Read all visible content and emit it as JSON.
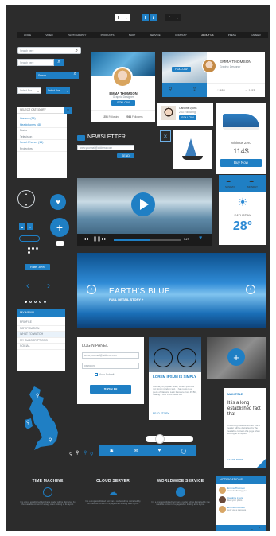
{
  "social": {
    "icons": [
      "f",
      "t",
      "f",
      "t",
      "f",
      "t"
    ]
  },
  "nav": {
    "items": [
      "HOME",
      "VIDEO",
      "PHOTOGRAPHY",
      "PRODUCTS",
      "SHOP",
      "SERVICE",
      "COMPANY",
      "ABOUT US",
      "PRESS",
      "CAREER"
    ],
    "active": 7
  },
  "search": {
    "placeholder1": "Search here",
    "placeholder2": "Search here",
    "button": "Search"
  },
  "selects": {
    "a": "Select Box",
    "b": "Select Box"
  },
  "category": {
    "header": "SELECT CATEGORY",
    "items": [
      "Camera (35)",
      "Headphones (48)",
      "Radio",
      "Television",
      "Smart Phones (14)",
      "Projectors"
    ]
  },
  "profile1": {
    "name": "EMMA THOMSON",
    "role": "Graphic Designer",
    "button": "FOLLOW",
    "stats": [
      {
        "n": "253",
        "t": "Following"
      },
      {
        "n": "2564",
        "t": "Followers"
      }
    ]
  },
  "profile2": {
    "name": "EMMA THOMSON",
    "role": "Graphic Designer",
    "button": "FOLLOW",
    "stats": [
      "654",
      "1453"
    ]
  },
  "profile3": {
    "name": "Caroline Lyons",
    "role": "253 Following",
    "button": "FOLLOW"
  },
  "newsletter": {
    "title": "NEWSLETTER",
    "placeholder": "www.yourmail@address.com",
    "button": "SEND"
  },
  "shoe": {
    "name": "Minimus Zero",
    "price": "114$",
    "button": "Buy Now"
  },
  "weather": {
    "d1": "SUNDAY",
    "d2": "MONDAY",
    "day": "SATURDAY",
    "temp": "28°"
  },
  "player": {
    "time": "3:47"
  },
  "rate": {
    "label": "Rate: 30%"
  },
  "hero": {
    "title": "EARTH'S BLUE",
    "sub": "FULL DETAIL STORY +"
  },
  "menu": {
    "header": "MY MENU",
    "items": [
      "PROFILE",
      "NOTIFICATION",
      "WHAT TO WATCH",
      "MY SUBSCRIPTIONS",
      "SOCIAL"
    ]
  },
  "login": {
    "title": "LOGIN PANEL",
    "user": "www.yourmail@address.com",
    "pass": "password",
    "remember": "Auto Submit",
    "button": "SIGN IN"
  },
  "lorem": {
    "title": "LOREM IPSUM IS SIMPLY",
    "text": "Contrary to popular belief, Lorem Ipsum is not simply random text. It has roots in a piece of classical Latin literature from 45 BC, making it over 2000 years old.",
    "link": "READ STORY"
  },
  "info": {
    "label": "MAIN TITLE",
    "title": "It is a long established fact that",
    "text": "It is a long established fact that a reader will be distracted by the readable content of a page when looking at its layout.",
    "link": "LEARN MORE"
  },
  "services": [
    {
      "title": "TIME MACHINE",
      "text": "It is a long established fact that a reader will be distracted by the readable content of a page when looking at its layout."
    },
    {
      "title": "CLOUD SERVER",
      "text": "It is a long established fact that a reader will be distracted by the readable content of a page when looking at its layout."
    },
    {
      "title": "WORLDWIDE SERVICE",
      "text": "It is a long established fact that a reader will be distracted by the readable content of a page when looking at its layout."
    }
  ],
  "notifications": {
    "title": "NOTIFICATIONS",
    "items": [
      {
        "name": "Emma Thomson",
        "text": "started following you"
      },
      {
        "name": "Caroline Lyons",
        "text": "liked your photo"
      },
      {
        "name": "Emma Thomson",
        "text": "sent you a message"
      }
    ]
  }
}
